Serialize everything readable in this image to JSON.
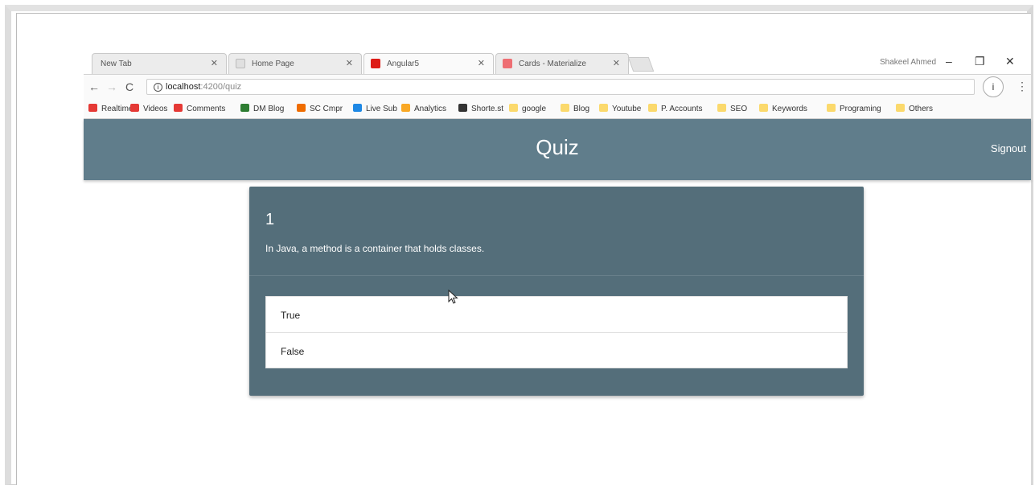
{
  "tabs": [
    {
      "label": "New Tab",
      "favicon_color": "#ececec"
    },
    {
      "label": "Home Page",
      "favicon_color": "#dddddd"
    },
    {
      "label": "Angular5",
      "favicon_color": "#dd1b16"
    },
    {
      "label": "Cards - Materialize",
      "favicon_color": "#ee6e73"
    }
  ],
  "window": {
    "user": "Shakeel Ahmed",
    "minimize": "–",
    "restore": "❐",
    "close": "✕"
  },
  "address": {
    "host": "localhost",
    "path": ":4200/quiz",
    "info": "i"
  },
  "bookmarks": [
    {
      "label": "Realtime",
      "icon_color": "#e53935"
    },
    {
      "label": "Videos",
      "icon_color": "#e53935"
    },
    {
      "label": "Comments",
      "icon_color": "#e53935"
    },
    {
      "label": "DM Blog",
      "icon_color": "#2e7d32"
    },
    {
      "label": "SC Cmpr",
      "icon_color": "#ef6c00"
    },
    {
      "label": "Live Sub",
      "icon_color": "#1e88e5"
    },
    {
      "label": "Analytics",
      "icon_color": "#f9a825"
    },
    {
      "label": "Shorte.st",
      "icon_color": "#333333"
    },
    {
      "label": "google",
      "icon_color": "#fbd96c"
    },
    {
      "label": "Blog",
      "icon_color": "#fbd96c"
    },
    {
      "label": "Youtube",
      "icon_color": "#fbd96c"
    },
    {
      "label": "P. Accounts",
      "icon_color": "#fbd96c"
    },
    {
      "label": "SEO",
      "icon_color": "#fbd96c"
    },
    {
      "label": "Keywords",
      "icon_color": "#fbd96c"
    },
    {
      "label": "Programing",
      "icon_color": "#fbd96c"
    },
    {
      "label": "Others",
      "icon_color": "#fbd96c"
    }
  ],
  "app": {
    "title": "Quiz",
    "signout": "Signout",
    "header_color": "#607d8b",
    "card_color": "#546e7a"
  },
  "question": {
    "number": "1",
    "text": "In Java, a method is a container that holds classes.",
    "answers": [
      "True",
      "False"
    ]
  }
}
